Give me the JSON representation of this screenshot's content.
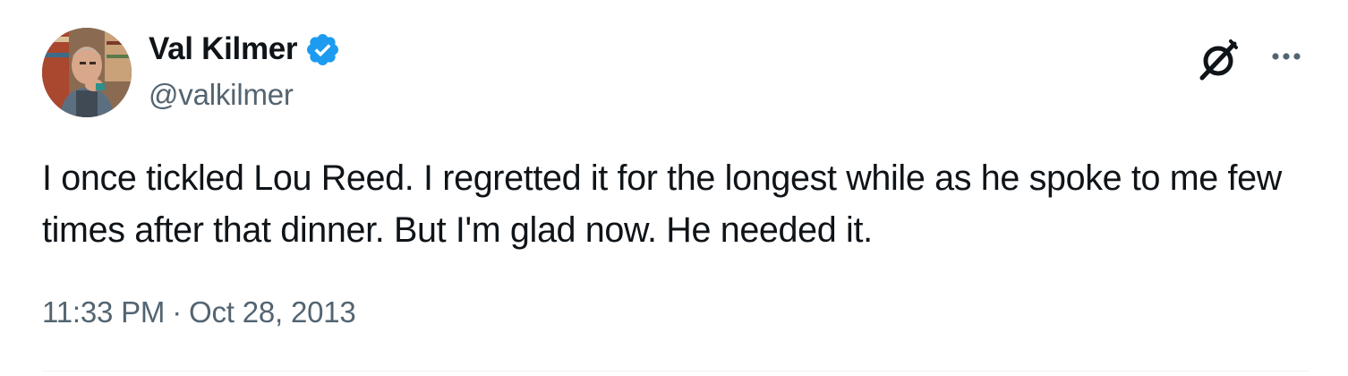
{
  "author": {
    "display_name": "Val Kilmer",
    "handle": "@valkilmer",
    "verified": true
  },
  "tweet": {
    "text": "I once tickled Lou Reed. I regretted it for the longest while as he spoke to me few times after that dinner. But I'm glad now. He needed it.",
    "time": "11:33 PM",
    "separator": "·",
    "date": "Oct 28, 2013"
  },
  "icons": {
    "verified": "verified-badge-icon",
    "grok": "grok-icon",
    "more": "more-options-icon"
  },
  "colors": {
    "text": "#0f1419",
    "secondary": "#536471",
    "verified_blue": "#1d9bf0",
    "divider": "#eff3f4"
  }
}
